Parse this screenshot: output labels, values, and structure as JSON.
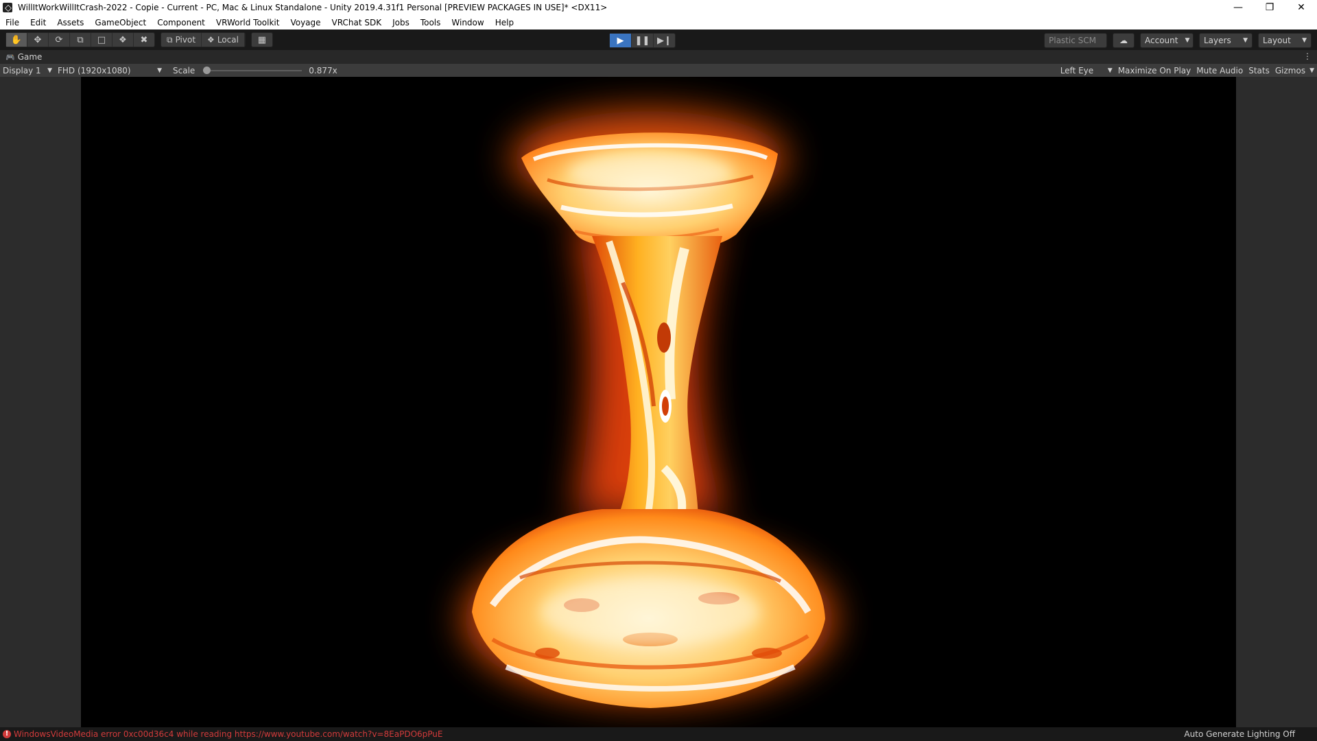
{
  "window": {
    "title": "WillItWorkWillItCrash-2022 - Copie - Current - PC, Mac & Linux Standalone - Unity 2019.4.31f1 Personal [PREVIEW PACKAGES IN USE]* <DX11>",
    "minimize_icon": "minimize-icon",
    "restore_icon": "restore-icon",
    "close_icon": "close-icon"
  },
  "menu": [
    "File",
    "Edit",
    "Assets",
    "GameObject",
    "Component",
    "VRWorld Toolkit",
    "Voyage",
    "VRChat SDK",
    "Jobs",
    "Tools",
    "Window",
    "Help"
  ],
  "toolbar": {
    "tools": [
      "hand-icon",
      "move-icon",
      "rotate-icon",
      "scale-icon",
      "rect-icon",
      "transform-icon",
      "custom-tool-icon"
    ],
    "pivot_label": "Pivot",
    "local_label": "Local",
    "grid_icon": "grid-snap-icon",
    "play_icon": "play-icon",
    "pause_icon": "pause-icon",
    "step_icon": "step-icon",
    "plastic_label": "Plastic SCM",
    "cloud_icon": "cloud-icon",
    "account_label": "Account",
    "layers_label": "Layers",
    "layout_label": "Layout"
  },
  "game_tab": {
    "label": "Game",
    "icon": "gamepad-icon"
  },
  "game_bar": {
    "display": "Display 1",
    "resolution": "FHD (1920x1080)",
    "scale_label": "Scale",
    "scale_value": "0.877x",
    "scale_fraction": 0.0,
    "eye": "Left Eye",
    "maximize": "Maximize On Play",
    "mute": "Mute Audio",
    "stats": "Stats",
    "gizmos": "Gizmos"
  },
  "status": {
    "error": "WindowsVideoMedia error 0xc00d36c4 while reading https://www.youtube.com/watch?v=8EaPDO6pPuE",
    "lighting": "Auto Generate Lighting Off"
  },
  "colors": {
    "accent_play": "#3a74c0",
    "error_red": "#d23b3b",
    "fire_core": "#fff6d8",
    "fire_mid": "#ffb020",
    "fire_edge": "#e04a08"
  }
}
